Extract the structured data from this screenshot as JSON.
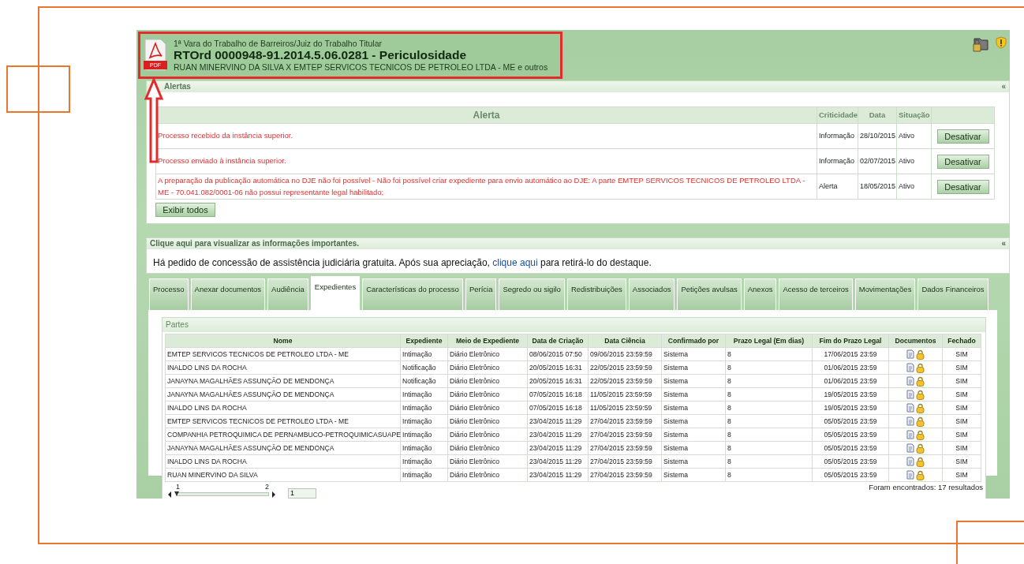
{
  "header": {
    "file_badge": "PDF",
    "court": "1ª Vara do Trabalho de Barreiros/Juiz do Trabalho Titular",
    "title": "RTOrd 0000948-91.2014.5.06.0281 - Periculosidade",
    "parties": "RUAN MINERVINO DA SILVA X EMTEP SERVICOS TECNICOS DE PETROLEO LTDA - ME e outros",
    "highlighted": true
  },
  "alerts_panel": {
    "title": "Alertas",
    "collapse": "«",
    "columns": [
      "Alerta",
      "Criticidade",
      "Data",
      "Situação"
    ],
    "rows": [
      {
        "alerta": "Processo recebido da instância superior.",
        "criticidade": "Informação",
        "data": "28/10/2015",
        "situacao": "Ativo",
        "action": "Desativar"
      },
      {
        "alerta": "Processo enviado à instância superior.",
        "criticidade": "Informação",
        "data": "02/07/2015",
        "situacao": "Ativo",
        "action": "Desativar"
      },
      {
        "alerta": "A preparação da publicação automática no DJE não foi possível - Não foi possível criar expediente para envio automático ao DJE: A parte EMTEP SERVICOS TECNICOS DE PETROLEO LTDA - ME - 70.041.082/0001-06 não possui representante legal habilitado;",
        "criticidade": "Alerta",
        "data": "18/05/2015",
        "situacao": "Ativo",
        "action": "Desativar"
      }
    ],
    "show_all": "Exibir todos"
  },
  "info_panel": {
    "title": "Clique aqui para visualizar as informações importantes.",
    "collapse": "«",
    "text_before": "Há pedido de concessão de assistência judiciária gratuita. Após sua apreciação, ",
    "link": "clique aqui",
    "text_after": " para retirá-lo do destaque."
  },
  "tabs": [
    {
      "label": "Processo",
      "selected": false
    },
    {
      "label": "Anexar documentos",
      "selected": false
    },
    {
      "label": "Audiência",
      "selected": false
    },
    {
      "label": "Expedientes",
      "selected": true
    },
    {
      "label": "Características do processo",
      "selected": false
    },
    {
      "label": "Perícia",
      "selected": false
    },
    {
      "label": "Segredo ou sigilo",
      "selected": false
    },
    {
      "label": "Redistribuições",
      "selected": false
    },
    {
      "label": "Associados",
      "selected": false
    },
    {
      "label": "Petições avulsas",
      "selected": false
    },
    {
      "label": "Anexos",
      "selected": false
    },
    {
      "label": "Acesso de terceiros",
      "selected": false
    },
    {
      "label": "Movimentações",
      "selected": false
    },
    {
      "label": "Dados Financeiros",
      "selected": false
    }
  ],
  "partes": {
    "title": "Partes",
    "columns": [
      "Nome",
      "Expediente",
      "Meio de Expediente",
      "Data de Criação",
      "Data Ciência",
      "Confirmado por",
      "Prazo Legal (Em dias)",
      "Fim do Prazo Legal",
      "Documentos",
      "Fechado"
    ],
    "rows": [
      [
        "EMTEP SERVICOS TECNICOS DE PETROLEO LTDA - ME",
        "Intimação",
        "Diário Eletrônico",
        "08/06/2015 07:50",
        "09/06/2015 23:59:59",
        "Sistema",
        "8",
        "17/06/2015 23:59",
        "SIM"
      ],
      [
        "INALDO LINS DA ROCHA",
        "Notificação",
        "Diário Eletrônico",
        "20/05/2015 16:31",
        "22/05/2015 23:59:59",
        "Sistema",
        "8",
        "01/06/2015 23:59",
        "SIM"
      ],
      [
        "JANAYNA MAGALHÃES ASSUNÇÃO DE MENDONÇA",
        "Notificação",
        "Diário Eletrônico",
        "20/05/2015 16:31",
        "22/05/2015 23:59:59",
        "Sistema",
        "8",
        "01/06/2015 23:59",
        "SIM"
      ],
      [
        "JANAYNA MAGALHÃES ASSUNÇÃO DE MENDONÇA",
        "Intimação",
        "Diário Eletrônico",
        "07/05/2015 16:18",
        "11/05/2015 23:59:59",
        "Sistema",
        "8",
        "19/05/2015 23:59",
        "SIM"
      ],
      [
        "INALDO LINS DA ROCHA",
        "Intimação",
        "Diário Eletrônico",
        "07/05/2015 16:18",
        "11/05/2015 23:59:59",
        "Sistema",
        "8",
        "19/05/2015 23:59",
        "SIM"
      ],
      [
        "EMTEP SERVICOS TECNICOS DE PETROLEO LTDA - ME",
        "Intimação",
        "Diário Eletrônico",
        "23/04/2015 11:29",
        "27/04/2015 23:59:59",
        "Sistema",
        "8",
        "05/05/2015 23:59",
        "SIM"
      ],
      [
        "COMPANHIA PETROQUIMICA DE PERNAMBUCO-PETROQUIMICASUAPE",
        "Intimação",
        "Diário Eletrônico",
        "23/04/2015 11:29",
        "27/04/2015 23:59:59",
        "Sistema",
        "8",
        "05/05/2015 23:59",
        "SIM"
      ],
      [
        "JANAYNA MAGALHÃES ASSUNÇÃO DE MENDONÇA",
        "Intimação",
        "Diário Eletrônico",
        "23/04/2015 11:29",
        "27/04/2015 23:59:59",
        "Sistema",
        "8",
        "05/05/2015 23:59",
        "SIM"
      ],
      [
        "INALDO LINS DA ROCHA",
        "Intimação",
        "Diário Eletrônico",
        "23/04/2015 11:29",
        "27/04/2015 23:59:59",
        "Sistema",
        "8",
        "05/05/2015 23:59",
        "SIM"
      ],
      [
        "RUAN MINERVINO DA SILVA",
        "Intimação",
        "Diário Eletrônico",
        "23/04/2015 11:29",
        "27/04/2015 23:59:59",
        "Sistema",
        "8",
        "05/05/2015 23:59",
        "SIM"
      ]
    ],
    "pager": {
      "first": "1",
      "last": "2",
      "level": 0,
      "page": "1"
    },
    "result_count": "Foram encontrados: 17 resultados"
  }
}
